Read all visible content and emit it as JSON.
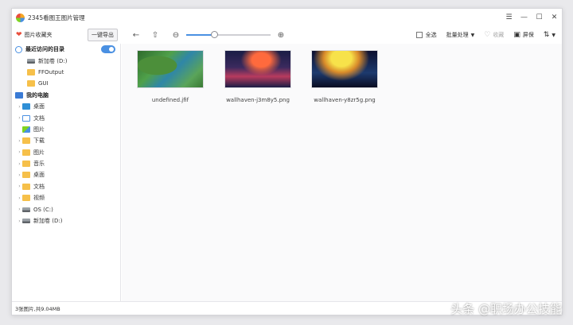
{
  "app": {
    "title": "2345看图王图片管理"
  },
  "toolbar": {
    "favorites_label": "图片收藏夹",
    "import_label": "一键导出",
    "select_all_label": "全选",
    "batch_label": "批量处理",
    "collect_label": "收藏",
    "screen_label": "屏保",
    "zoom_level": 0.33
  },
  "sidebar": {
    "recent_title": "最近访问的目录",
    "recent_items": [
      {
        "label": "新加卷 (D:)",
        "icon": "drive-icon"
      },
      {
        "label": "FFOutput",
        "icon": "folder-icon"
      },
      {
        "label": "GUI",
        "icon": "folder-icon"
      }
    ],
    "pc_title": "我的电脑",
    "pc_items": [
      {
        "label": "桌面",
        "icon": "desktop-icon"
      },
      {
        "label": "文档",
        "icon": "document-icon"
      },
      {
        "label": "图片",
        "icon": "picture-icon"
      },
      {
        "label": "下载",
        "icon": "folder-icon"
      },
      {
        "label": "图片",
        "icon": "folder-icon"
      },
      {
        "label": "音乐",
        "icon": "folder-icon"
      },
      {
        "label": "桌面",
        "icon": "folder-icon"
      },
      {
        "label": "文档",
        "icon": "folder-icon"
      },
      {
        "label": "视频",
        "icon": "folder-icon"
      },
      {
        "label": "OS (C:)",
        "icon": "drive-icon"
      },
      {
        "label": "新加卷 (D:)",
        "icon": "drive-icon"
      }
    ]
  },
  "files": [
    {
      "name": "undefined.jfif"
    },
    {
      "name": "wallhaven-j3m8y5.png"
    },
    {
      "name": "wallhaven-y8zr5g.png"
    }
  ],
  "status": {
    "summary": "3张图片,共9.04MB"
  },
  "watermark": {
    "text": "头条 @职场办公技能"
  }
}
